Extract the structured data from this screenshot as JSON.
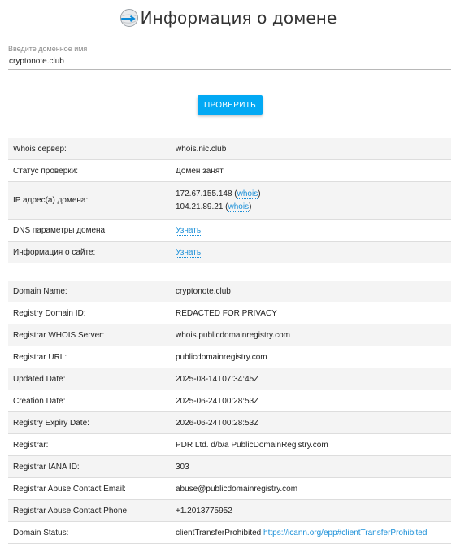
{
  "header": {
    "title": "Информация о домене",
    "logo_icon": "domain-search-icon"
  },
  "search": {
    "label": "Введите доменное имя",
    "value": "cryptonote.club"
  },
  "check_button": {
    "label": "ПРОВЕРИТЬ"
  },
  "summary": {
    "whois_server": {
      "label": "Whois сервер:",
      "value": "whois.nic.club"
    },
    "status": {
      "label": "Статус проверки:",
      "value": "Домен занят"
    },
    "ips": {
      "label": "IP адрес(а) домена:",
      "items": [
        {
          "ip": "172.67.155.148",
          "link": "whois"
        },
        {
          "ip": "104.21.89.21",
          "link": "whois"
        }
      ]
    },
    "dns": {
      "label": "DNS параметры домена:",
      "link": "Узнать"
    },
    "site_info": {
      "label": "Информация о сайте:",
      "link": "Узнать"
    }
  },
  "whois": [
    {
      "key": "Domain Name:",
      "value": "cryptonote.club"
    },
    {
      "key": "Registry Domain ID:",
      "value": "REDACTED FOR PRIVACY"
    },
    {
      "key": "Registrar WHOIS Server:",
      "value": "whois.publicdomainregistry.com"
    },
    {
      "key": "Registrar URL:",
      "value": "publicdomainregistry.com"
    },
    {
      "key": "Updated Date:",
      "value": "2025-08-14T07:34:45Z"
    },
    {
      "key": "Creation Date:",
      "value": "2025-06-24T00:28:53Z"
    },
    {
      "key": "Registry Expiry Date:",
      "value": "2026-06-24T00:28:53Z"
    },
    {
      "key": "Registrar:",
      "value": "PDR Ltd. d/b/a PublicDomainRegistry.com"
    },
    {
      "key": "Registrar IANA ID:",
      "value": "303"
    },
    {
      "key": "Registrar Abuse Contact Email:",
      "value": "abuse@publicdomainregistry.com"
    },
    {
      "key": "Registrar Abuse Contact Phone:",
      "value": "+1.2013775952"
    },
    {
      "key": "Domain Status:",
      "value": "clientTransferProhibited",
      "link": "https://icann.org/epp#clientTransferProhibited"
    }
  ],
  "colors": {
    "accent": "#03a9f4",
    "link": "#1a8fd8",
    "stripe": "#f4f4f4"
  }
}
